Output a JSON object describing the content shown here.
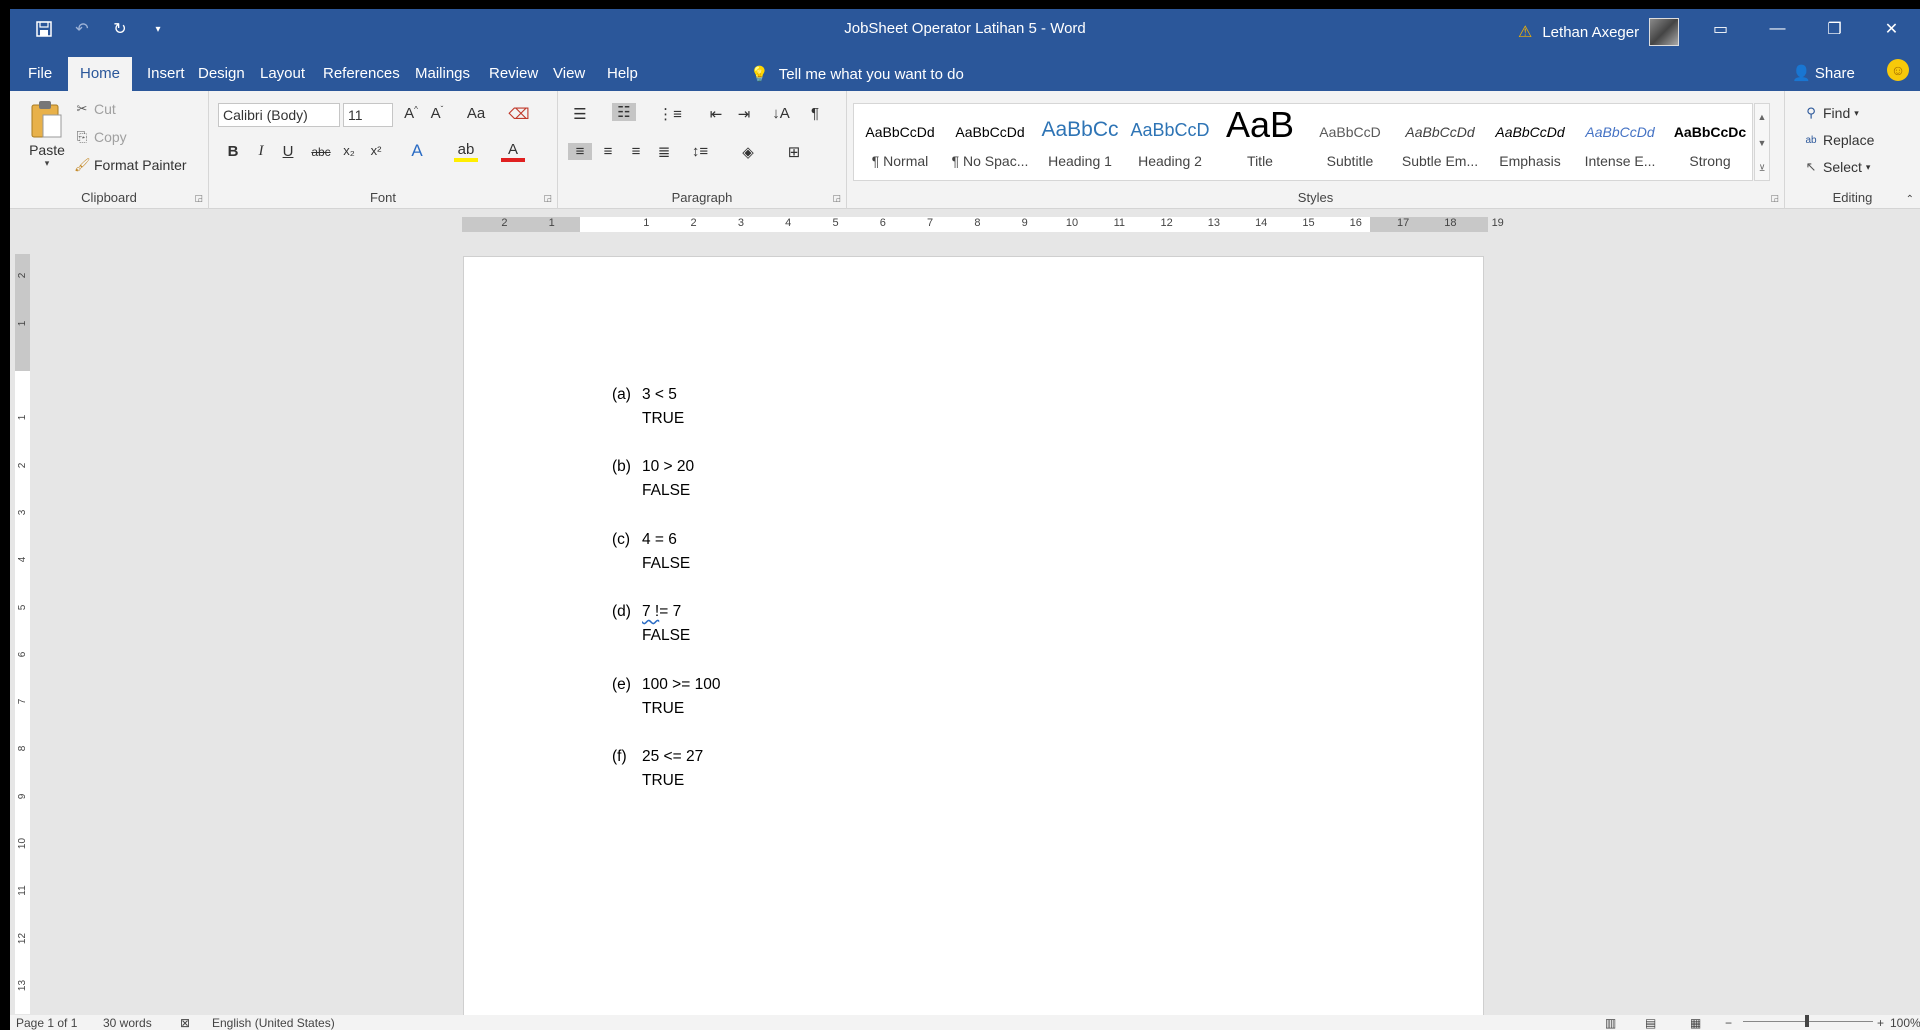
{
  "window": {
    "title": "JobSheet Operator Latihan 5  -  Word",
    "user_name": "Lethan Axeger",
    "warning_icon": "warning-triangle-icon"
  },
  "tabs": [
    "File",
    "Home",
    "Insert",
    "Design",
    "Layout",
    "References",
    "Mailings",
    "Review",
    "View",
    "Help"
  ],
  "tell_me": "Tell me what you want to do",
  "share": "Share",
  "clipboard": {
    "paste": "Paste",
    "cut": "Cut",
    "copy": "Copy",
    "format_painter": "Format Painter",
    "label": "Clipboard"
  },
  "font": {
    "family": "Calibri (Body)",
    "size": "11",
    "label": "Font",
    "change_case": "Aa"
  },
  "paragraph": {
    "label": "Paragraph"
  },
  "styles": {
    "label": "Styles",
    "items": [
      {
        "preview": "AaBbCcDd",
        "name": "¶ Normal"
      },
      {
        "preview": "AaBbCcDd",
        "name": "¶ No Spac..."
      },
      {
        "preview": "AaBbCc",
        "name": "Heading 1"
      },
      {
        "preview": "AaBbCcD",
        "name": "Heading 2"
      },
      {
        "preview": "AaB",
        "name": "Title"
      },
      {
        "preview": "AaBbCcD",
        "name": "Subtitle"
      },
      {
        "preview": "AaBbCcDd",
        "name": "Subtle Em..."
      },
      {
        "preview": "AaBbCcDd",
        "name": "Emphasis"
      },
      {
        "preview": "AaBbCcDd",
        "name": "Intense E..."
      },
      {
        "preview": "AaBbCcDc",
        "name": "Strong"
      }
    ]
  },
  "editing": {
    "find": "Find",
    "replace": "Replace",
    "select": "Select",
    "label": "Editing"
  },
  "ruler": {
    "h_labels": [
      "2",
      "1",
      "1",
      "2",
      "3",
      "4",
      "5",
      "6",
      "7",
      "8",
      "9",
      "10",
      "11",
      "12",
      "13",
      "14",
      "15",
      "16",
      "17",
      "18",
      "19"
    ],
    "v_labels": [
      "2",
      "1",
      "1",
      "2",
      "3",
      "4",
      "5",
      "6",
      "7",
      "8",
      "9",
      "10",
      "11",
      "12",
      "13"
    ]
  },
  "document": {
    "items": [
      {
        "label": "(a)",
        "expr": "3 < 5",
        "answer": "TRUE"
      },
      {
        "label": "(b)",
        "expr": "10 > 20",
        "answer": "FALSE"
      },
      {
        "label": "(c)",
        "expr": "4 = 6",
        "answer": "FALSE"
      },
      {
        "label": "(d)",
        "expr_a": "7 !",
        "expr_b": "= 7",
        "answer": "FALSE"
      },
      {
        "label": "(e)",
        "expr": "100 >= 100",
        "answer": "TRUE"
      },
      {
        "label": "(f)",
        "expr": "25 <= 27",
        "answer": "TRUE"
      }
    ]
  },
  "status": {
    "page": "Page 1 of 1",
    "words": "30 words",
    "language": "English (United States)",
    "zoom": "100%"
  },
  "colors": {
    "accent": "#2b579a",
    "ribbon_bg": "#f3f3f3",
    "canvas_bg": "#e6e6e6"
  }
}
